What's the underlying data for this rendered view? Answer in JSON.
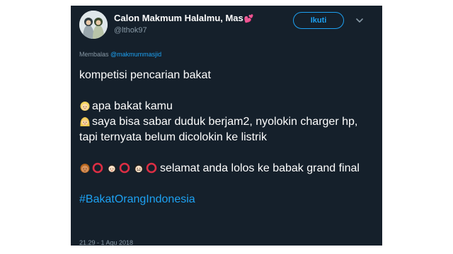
{
  "tweet": {
    "author": {
      "display_name": "Calon Makmum Halalmu, Mas",
      "heart_emoji": "💕",
      "handle": "@lthok97",
      "avatar": "avatar-two-hijab-girls"
    },
    "follow_label": "Ikuti",
    "menu_icon": "chevron-down-icon",
    "reply_prefix": "Membalas",
    "reply_mention": "@makmummasjid",
    "lines": {
      "line1": "kompetisi pencarian bakat",
      "question": "apa bakat kamu",
      "answer": "saya bisa sabar duduk berjam2, nyolokin charger hp, tapi ternyata belum dicolokin ke listrik",
      "result": "selamat anda lolos ke babak grand final"
    },
    "hashtag": "#BakatOrangIndonesia",
    "timestamp": "21.29 - 1 Agu 2018",
    "emojis": {
      "question": "blond-person-emoji",
      "answer": "blond-woman-emoji",
      "judges": [
        "man-face-emoji",
        "red-circle-emoji",
        "woman-face-emoji",
        "red-circle-emoji",
        "mustache-man-emoji",
        "red-circle-emoji"
      ]
    },
    "colors": {
      "background": "#15202b",
      "text": "#ffffff",
      "secondary": "#8899a6",
      "accent": "#1da1f2",
      "ring": "#dd2e44"
    }
  }
}
